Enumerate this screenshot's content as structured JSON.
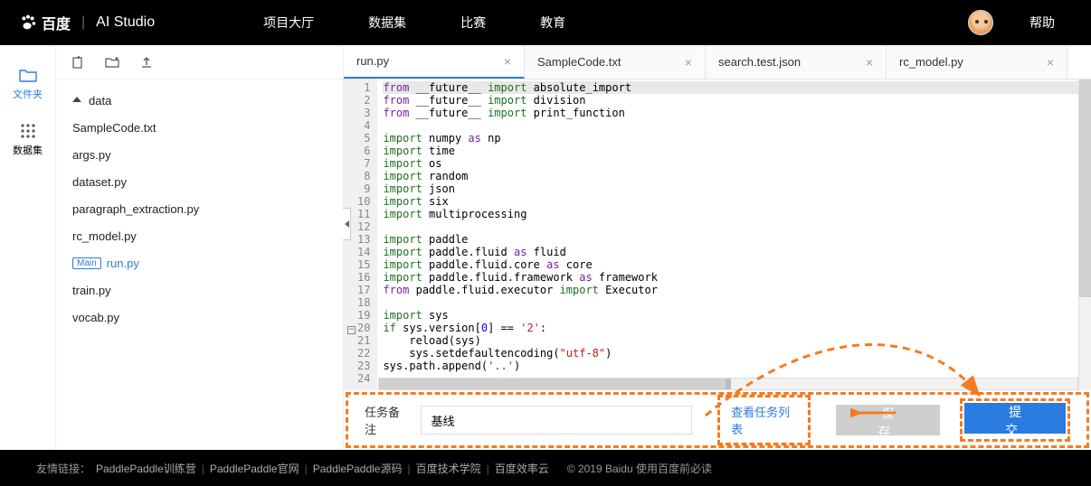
{
  "header": {
    "logo_brand": "百度",
    "logo_product": "AI Studio",
    "nav": [
      "项目大厅",
      "数据集",
      "比赛",
      "教育"
    ],
    "help": "帮助"
  },
  "left_rail": {
    "files": "文件夹",
    "datasets": "数据集"
  },
  "file_tree": {
    "folder": "data",
    "items": [
      {
        "name": "SampleCode.txt"
      },
      {
        "name": "args.py"
      },
      {
        "name": "dataset.py"
      },
      {
        "name": "paragraph_extraction.py"
      },
      {
        "name": "rc_model.py"
      },
      {
        "name": "run.py",
        "main": true
      },
      {
        "name": "train.py"
      },
      {
        "name": "vocab.py"
      }
    ],
    "main_badge": "Main"
  },
  "tabs": [
    {
      "label": "run.py",
      "active": true
    },
    {
      "label": "SampleCode.txt"
    },
    {
      "label": "search.test.json"
    },
    {
      "label": "rc_model.py"
    }
  ],
  "code_lines": [
    {
      "n": 1,
      "html": "<span class='kw-from'>from</span> <span class='id'>__future__</span> <span class='kw-import'>import</span> <span class='id'>absolute_import</span>",
      "hl": true
    },
    {
      "n": 2,
      "html": "<span class='kw-from'>from</span> <span class='id'>__future__</span> <span class='kw-import'>import</span> <span class='id'>division</span>"
    },
    {
      "n": 3,
      "html": "<span class='kw-from'>from</span> <span class='id'>__future__</span> <span class='kw-import'>import</span> <span class='id'>print_function</span>"
    },
    {
      "n": 4,
      "html": ""
    },
    {
      "n": 5,
      "html": "<span class='kw-import'>import</span> <span class='id'>numpy</span> <span class='kw-as'>as</span> <span class='id'>np</span>"
    },
    {
      "n": 6,
      "html": "<span class='kw-import'>import</span> <span class='id'>time</span>"
    },
    {
      "n": 7,
      "html": "<span class='kw-import'>import</span> <span class='id'>os</span>"
    },
    {
      "n": 8,
      "html": "<span class='kw-import'>import</span> <span class='id'>random</span>"
    },
    {
      "n": 9,
      "html": "<span class='kw-import'>import</span> <span class='id'>json</span>"
    },
    {
      "n": 10,
      "html": "<span class='kw-import'>import</span> <span class='id'>six</span>"
    },
    {
      "n": 11,
      "html": "<span class='kw-import'>import</span> <span class='id'>multiprocessing</span>"
    },
    {
      "n": 12,
      "html": ""
    },
    {
      "n": 13,
      "html": "<span class='kw-import'>import</span> <span class='id'>paddle</span>"
    },
    {
      "n": 14,
      "html": "<span class='kw-import'>import</span> <span class='id'>paddle.fluid</span> <span class='kw-as'>as</span> <span class='id'>fluid</span>"
    },
    {
      "n": 15,
      "html": "<span class='kw-import'>import</span> <span class='id'>paddle.fluid.core</span> <span class='kw-as'>as</span> <span class='id'>core</span>"
    },
    {
      "n": 16,
      "html": "<span class='kw-import'>import</span> <span class='id'>paddle.fluid.framework</span> <span class='kw-as'>as</span> <span class='id'>framework</span>"
    },
    {
      "n": 17,
      "html": "<span class='kw-from'>from</span> <span class='id'>paddle.fluid.executor</span> <span class='kw-import'>import</span> <span class='id'>Executor</span>"
    },
    {
      "n": 18,
      "html": ""
    },
    {
      "n": 19,
      "html": "<span class='kw-import'>import</span> <span class='id'>sys</span>"
    },
    {
      "n": 20,
      "html": "<span class='kw-if'>if</span> <span class='id'>sys.version</span>[<span class='num'>0</span>] == <span class='str'>'2'</span>:",
      "fold": true
    },
    {
      "n": 21,
      "html": "    <span class='id'>reload</span>(<span class='id'>sys</span>)"
    },
    {
      "n": 22,
      "html": "    <span class='id'>sys.setdefaultencoding</span>(<span class='str'>\"utf-8\"</span>)"
    },
    {
      "n": 23,
      "html": "<span class='id'>sys.path.append</span>(<span class='str'>'..'</span>)"
    },
    {
      "n": 24,
      "html": ""
    }
  ],
  "bottom": {
    "label": "任务备注",
    "value": "基线",
    "link": "查看任务列表",
    "save": "保 存",
    "submit": "提 交"
  },
  "footer": {
    "prefix": "友情链接：",
    "links": [
      "PaddlePaddle训练营",
      "PaddlePaddle官网",
      "PaddlePaddle源码",
      "百度技术学院",
      "百度效率云"
    ],
    "copyright": "© 2019 Baidu 使用百度前必读"
  }
}
